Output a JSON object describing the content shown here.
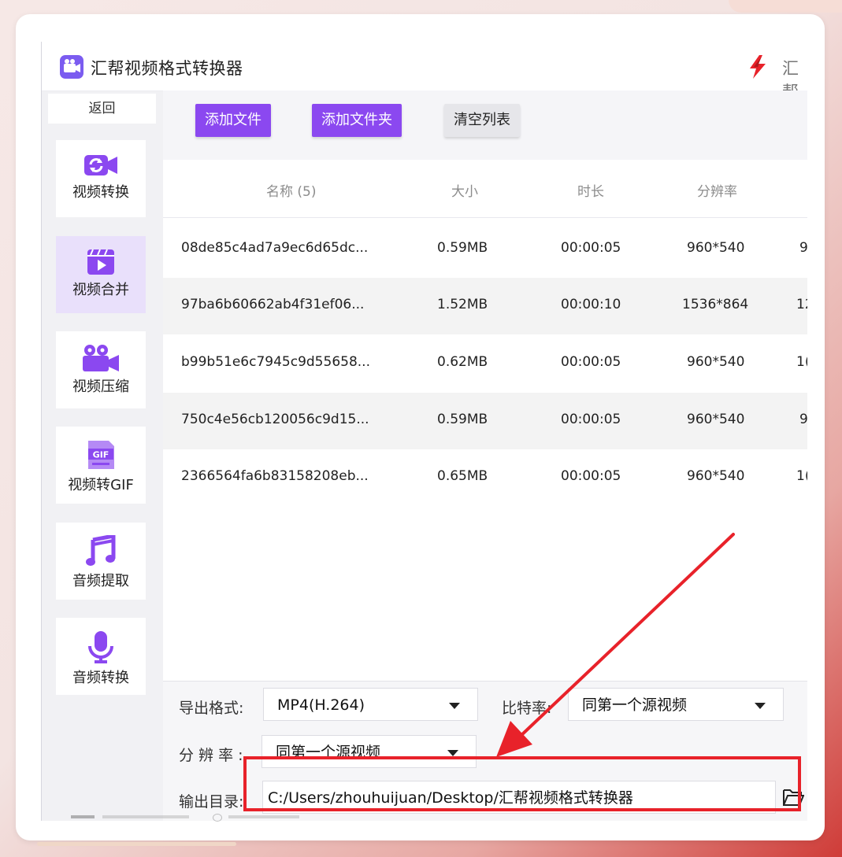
{
  "app": {
    "title": "汇帮视频格式转换器",
    "brand_text": "汇帮",
    "icon": "video-camera-app-icon",
    "brand_icon": "lightning-brand-logo"
  },
  "sidebar": {
    "back_label": "返回",
    "items": [
      {
        "label": "视频转换",
        "icon": "video-convert-icon",
        "active": false
      },
      {
        "label": "视频合并",
        "icon": "video-merge-icon",
        "active": true
      },
      {
        "label": "视频压缩",
        "icon": "video-compress-icon",
        "active": false
      },
      {
        "label": "视频转GIF",
        "icon": "gif-icon",
        "active": false
      },
      {
        "label": "音频提取",
        "icon": "music-note-icon",
        "active": false
      },
      {
        "label": "音频转换",
        "icon": "microphone-icon",
        "active": false
      }
    ]
  },
  "toolbar": {
    "add_file": "添加文件",
    "add_folder": "添加文件夹",
    "clear_list": "清空列表"
  },
  "table": {
    "headers": [
      "名称 (5)",
      "大小",
      "时长",
      "分辨率"
    ],
    "rows": [
      [
        "08de85c4ad7a9ec6d65dc...",
        "0.59MB",
        "00:00:05",
        "960*540",
        "9"
      ],
      [
        "97ba6b60662ab4f31ef06...",
        "1.52MB",
        "00:00:10",
        "1536*864",
        "12"
      ],
      [
        "b99b51e6c7945c9d55658...",
        "0.62MB",
        "00:00:05",
        "960*540",
        "1("
      ],
      [
        "750c4e56cb120056c9d15...",
        "0.59MB",
        "00:00:05",
        "960*540",
        "9"
      ],
      [
        "2366564fa6b83158208eb...",
        "0.65MB",
        "00:00:05",
        "960*540",
        "1("
      ]
    ]
  },
  "settings": {
    "format_label": "导出格式:",
    "format_value": "MP4(H.264)",
    "bitrate_label": "比特率:",
    "bitrate_value": "同第一个源视频",
    "resolution_label": "分 辨 率 :",
    "resolution_value": "同第一个源视频",
    "output_label": "输出目录:",
    "output_value": "C:/Users/zhouhuijuan/Desktop/汇帮视频格式转换器",
    "folder_icon": "folder-open-icon"
  },
  "colors": {
    "accent": "#8b48f0",
    "annotation": "#e8222a",
    "active_nav": "#e9e0fb"
  }
}
